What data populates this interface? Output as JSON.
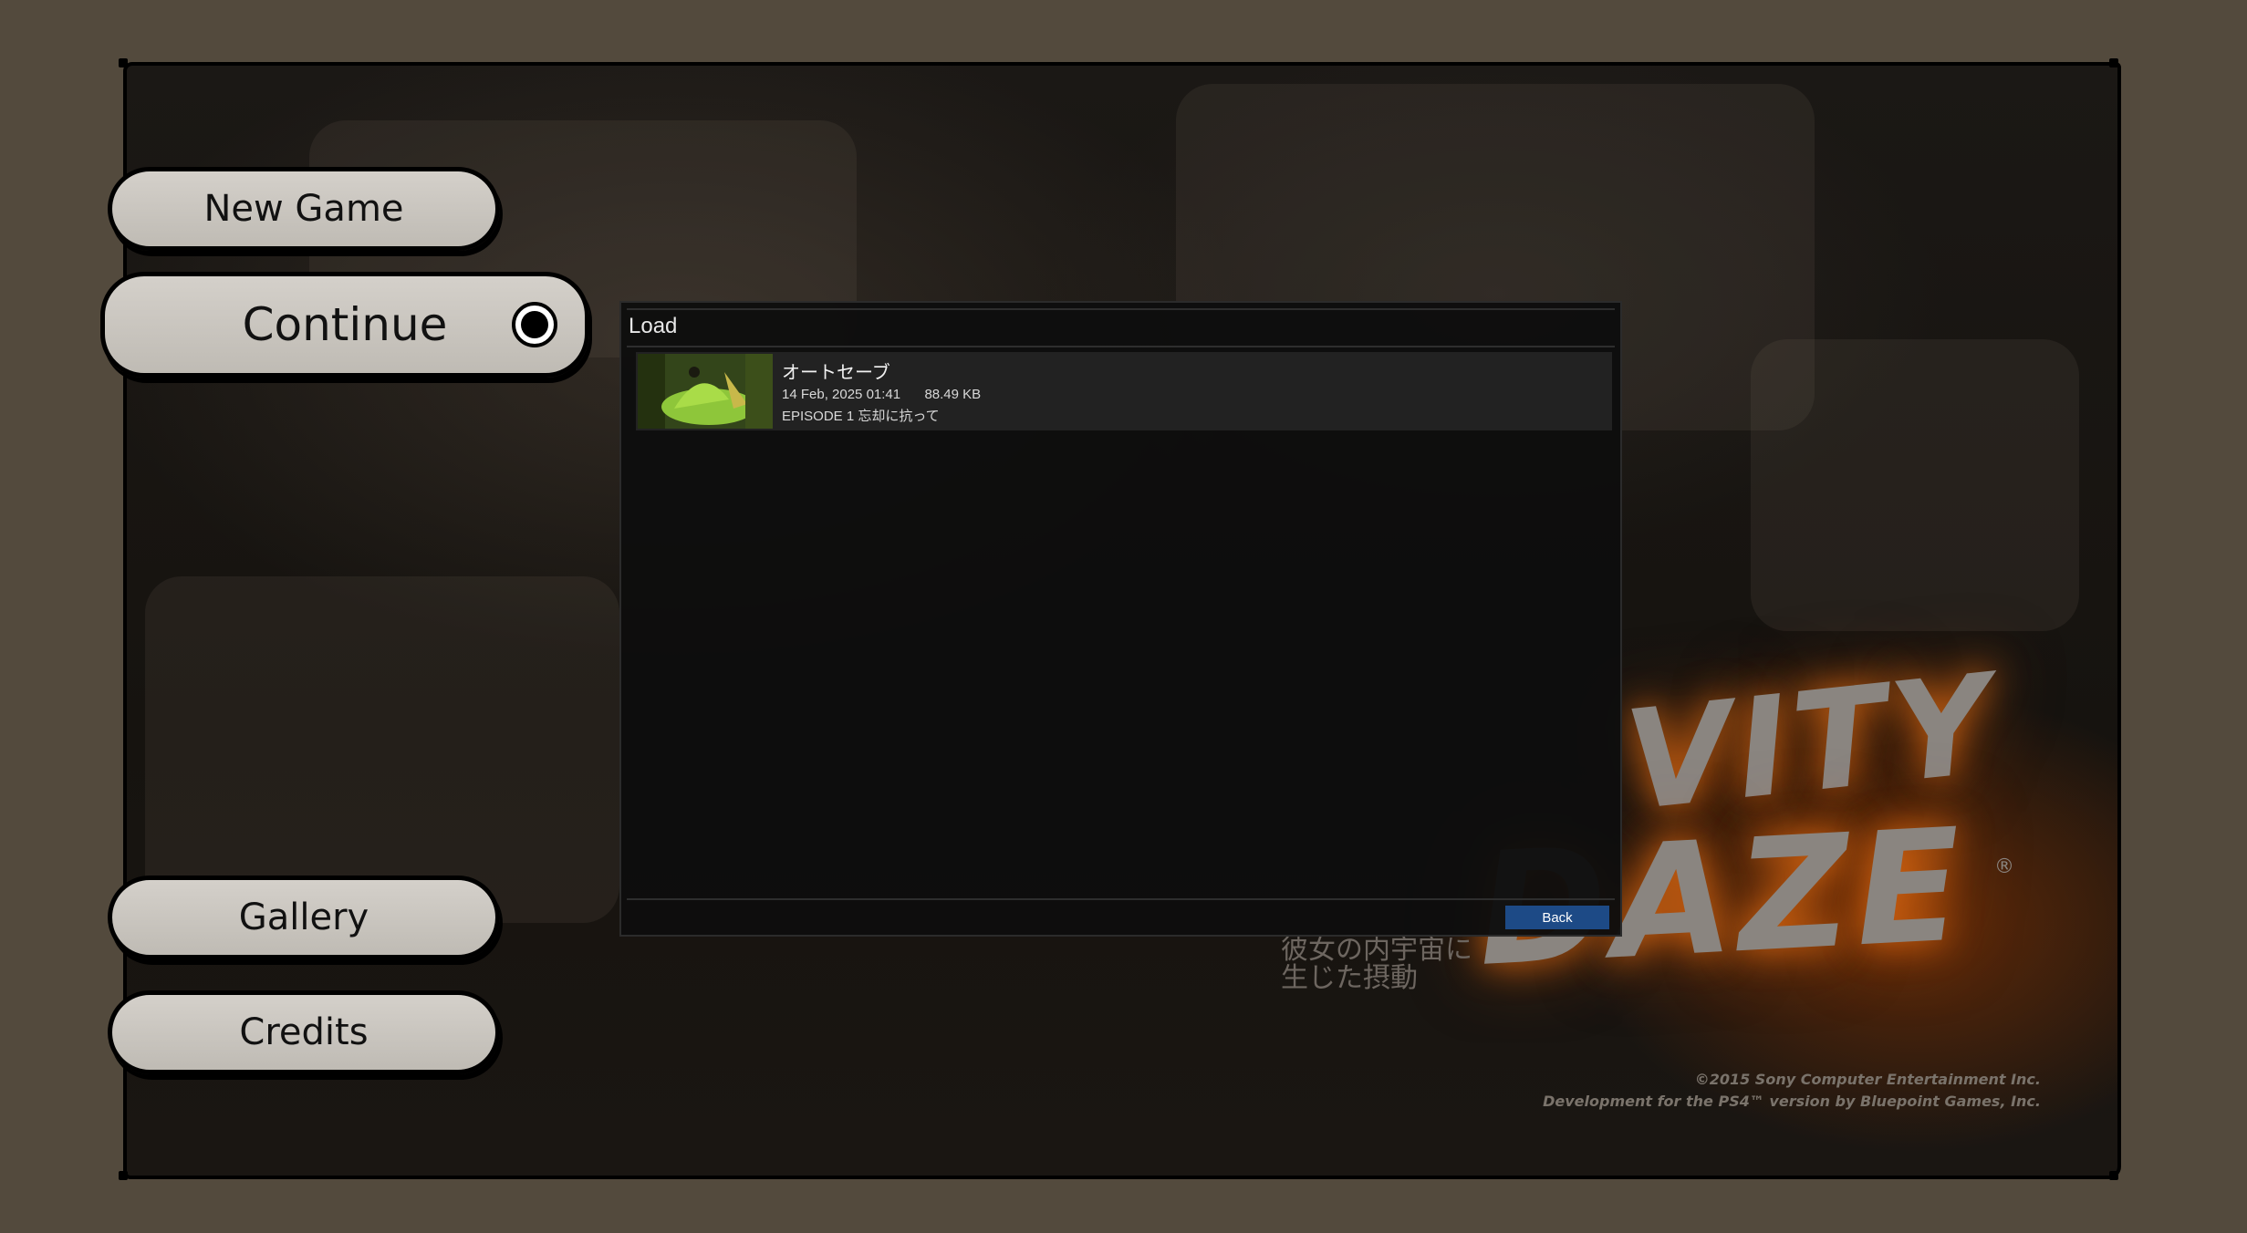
{
  "menu": {
    "new_game": "New Game",
    "continue": "Continue",
    "gallery": "Gallery",
    "credits": "Credits"
  },
  "background": {
    "logo_line1": "VITY",
    "logo_line2": "DAZE",
    "registered": "®",
    "japanese_tagline": [
      "彼女の内宇宙に",
      "生じた摂動"
    ],
    "copyright_line1": "©2015 Sony Computer Entertainment Inc.",
    "copyright_line2": "Development for the PS4™ version by Bluepoint Games, Inc."
  },
  "dialog": {
    "title": "Load",
    "saves": [
      {
        "name": "オートセーブ",
        "date": "14 Feb, 2025 01:41",
        "size": "88.49 KB",
        "episode": "EPISODE 1 忘却に抗って"
      }
    ],
    "back_label": "Back"
  },
  "colors": {
    "outer_bg": "#534a3d",
    "back_button": "#1d4a86",
    "logo_glow": "#e06e14"
  }
}
